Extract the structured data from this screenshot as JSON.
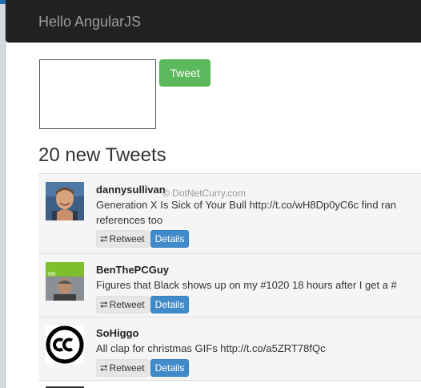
{
  "navbar": {
    "brand": "Hello AngularJS"
  },
  "composer": {
    "textarea_value": "",
    "tweet_button_label": "Tweet"
  },
  "feed": {
    "heading": "20 new Tweets",
    "retweet_label": "Retweet",
    "details_label": "Details",
    "tweets": [
      {
        "user": "dannysullivan",
        "text": "Generation X Is Sick of Your Bull http://t.co/wH8Dp0yC6c find ran references too",
        "avatar": "photo-avatar"
      },
      {
        "user": "BenThePCGuy",
        "text": "Figures that Black shows up on my #1020 18 hours after I get a #",
        "avatar": "photo-avatar"
      },
      {
        "user": "SoHiggo",
        "text": "All clap for christmas GIFs http://t.co/a5ZRT78fQc",
        "avatar": "creative-commons-logo"
      }
    ]
  },
  "watermark": {
    "text": "© DotNetCurry.com"
  },
  "icons": {
    "retweet": "retweet-icon"
  },
  "colors": {
    "navbar_bg": "#222222",
    "brand_text": "#9d9d9d",
    "tweet_button": "#5cb85c",
    "details_button": "#428bca",
    "row_bg": "#f5f5f5"
  }
}
